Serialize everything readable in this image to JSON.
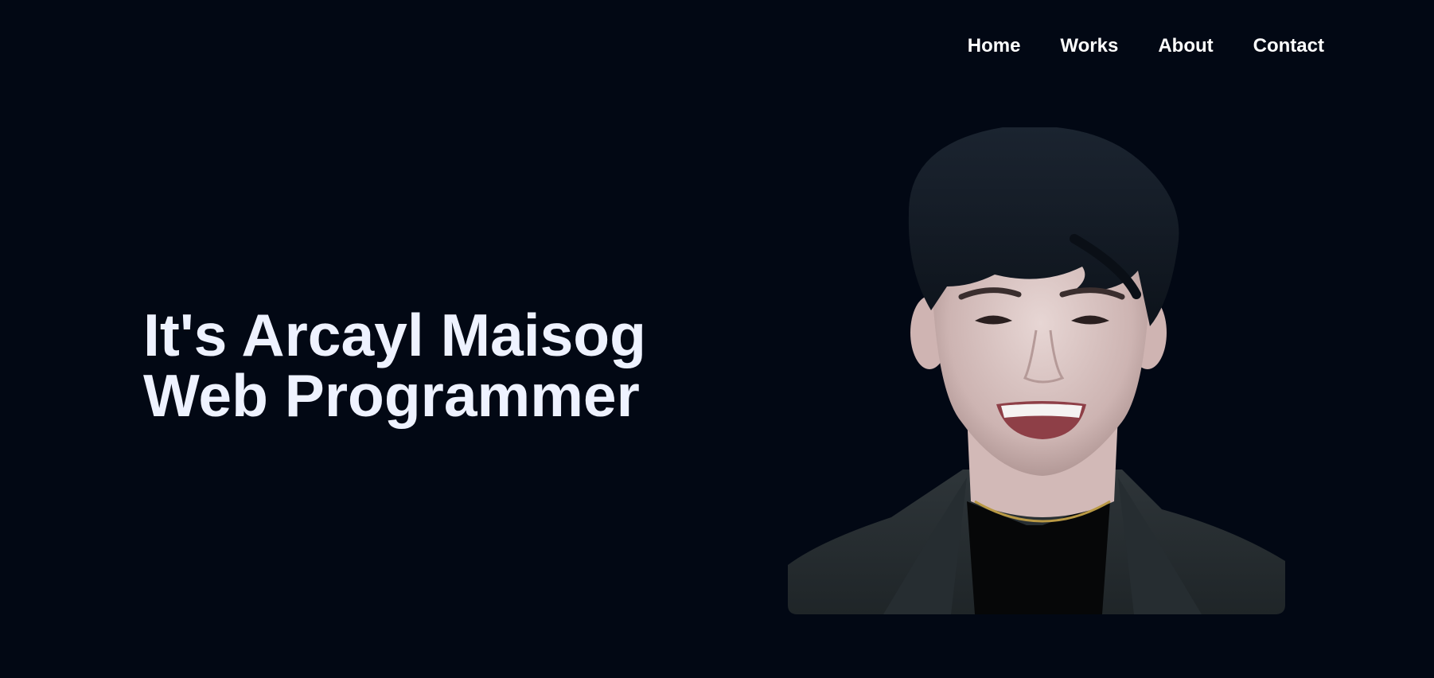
{
  "nav": {
    "items": [
      {
        "label": "Home"
      },
      {
        "label": "Works"
      },
      {
        "label": "About"
      },
      {
        "label": "Contact"
      }
    ]
  },
  "hero": {
    "line1": "It's Arcayl Maisog",
    "line2": "Web Programmer"
  },
  "portrait": {
    "icon": "person-portrait-photo"
  },
  "colors": {
    "background": "#020814",
    "nav_text": "#ffffff",
    "hero_text": "#eef2ff"
  }
}
